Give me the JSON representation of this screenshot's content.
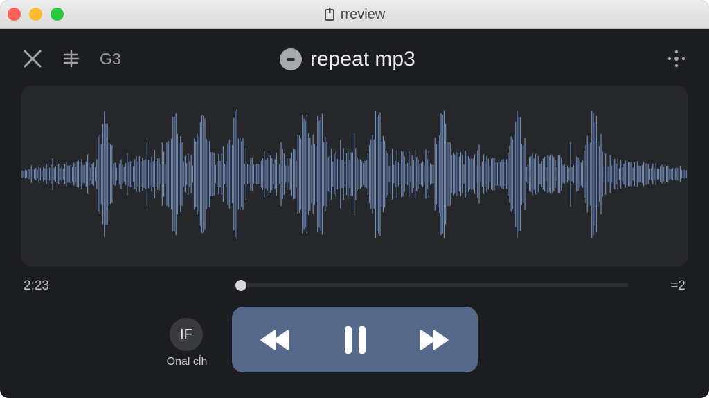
{
  "window": {
    "title": "rreview",
    "title_icon": "document-icon"
  },
  "toolbar": {
    "close_icon": "close-icon",
    "queue_icon": "queue-icon",
    "track_id": "G3",
    "more_icon": "more-icon"
  },
  "now_playing": {
    "icon": "disc-icon",
    "title": "repeat mp3"
  },
  "playback": {
    "elapsed": "2;23",
    "remaining": "=2",
    "progress": 0.0
  },
  "side_control": {
    "button_text": "IF",
    "label": "Onal cĺh"
  },
  "transport": {
    "rewind_icon": "rewind-icon",
    "pause_icon": "pause-icon",
    "fast_forward_icon": "fast-forward-icon"
  },
  "colors": {
    "background": "#1c1d20",
    "waveform": "#6a84b0",
    "transport_bg": "#56698a"
  }
}
